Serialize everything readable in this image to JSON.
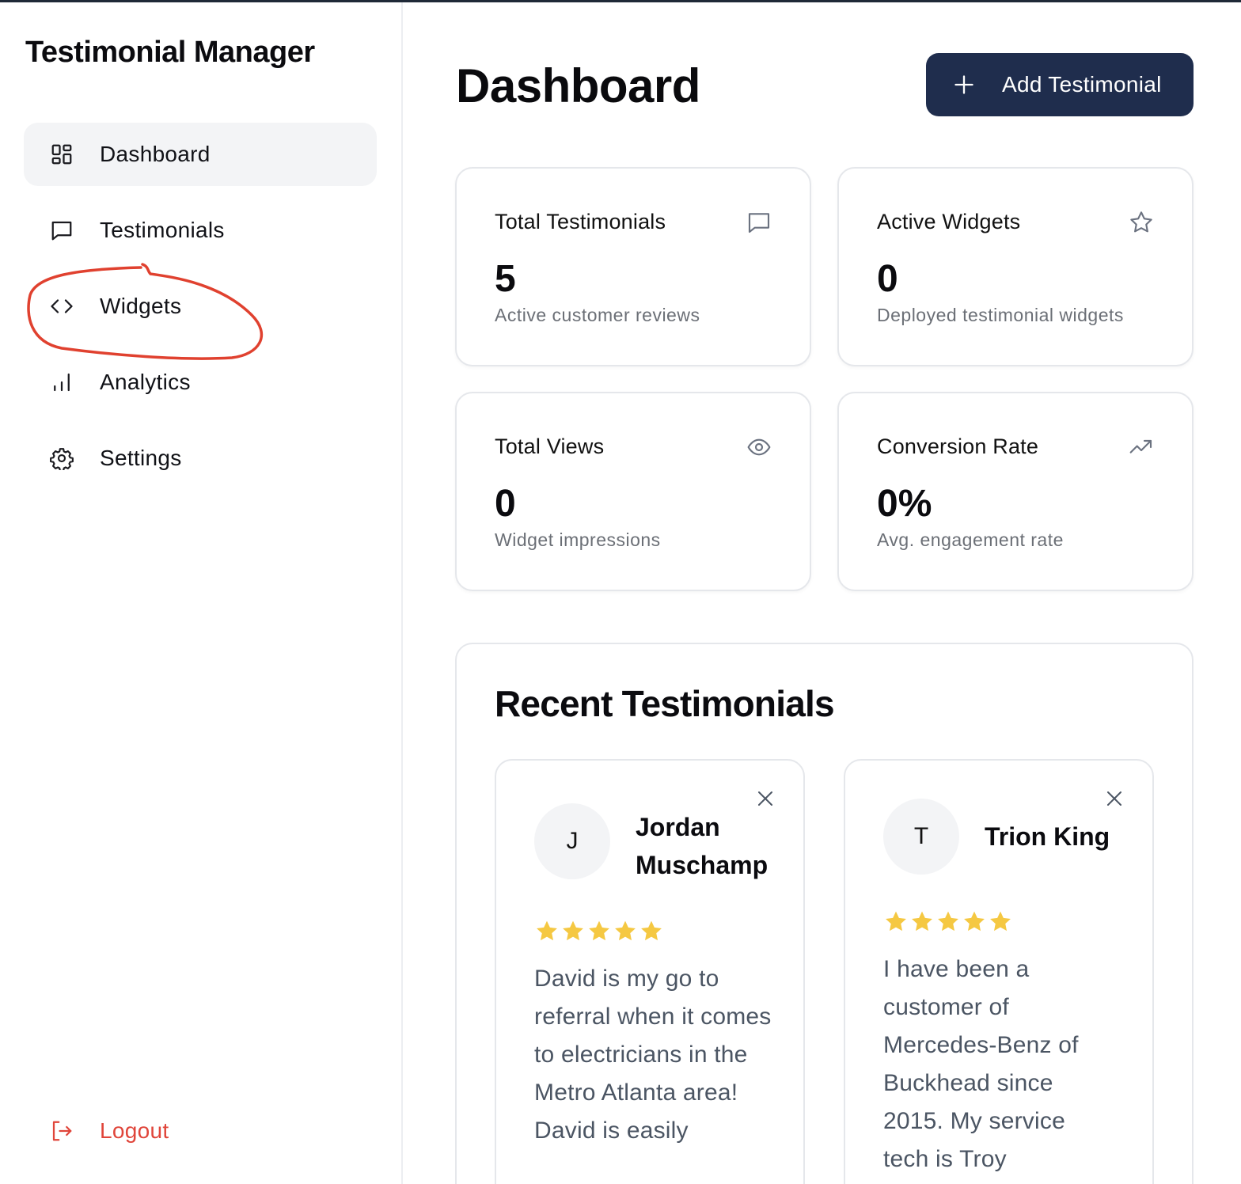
{
  "app": {
    "title": "Testimonial Manager"
  },
  "sidebar": {
    "items": [
      {
        "label": "Dashboard",
        "icon": "dashboard-grid-icon",
        "active": true
      },
      {
        "label": "Testimonials",
        "icon": "message-square-icon",
        "active": false
      },
      {
        "label": "Widgets",
        "icon": "code-icon",
        "active": false
      },
      {
        "label": "Analytics",
        "icon": "bar-chart-icon",
        "active": false
      },
      {
        "label": "Settings",
        "icon": "gear-icon",
        "active": false
      }
    ],
    "logout": {
      "label": "Logout",
      "icon": "logout-icon",
      "color": "#e0453a"
    }
  },
  "header": {
    "title": "Dashboard",
    "add_button": {
      "label": "Add Testimonial",
      "icon": "plus-icon",
      "color": "#1f2d4d"
    }
  },
  "stats": [
    {
      "title": "Total Testimonials",
      "value": "5",
      "subtitle": "Active customer reviews",
      "icon": "message-square-icon"
    },
    {
      "title": "Active Widgets",
      "value": "0",
      "subtitle": "Deployed testimonial widgets",
      "icon": "star-outline-icon"
    },
    {
      "title": "Total Views",
      "value": "0",
      "subtitle": "Widget impressions",
      "icon": "eye-icon"
    },
    {
      "title": "Conversion Rate",
      "value": "0%",
      "subtitle": "Avg. engagement rate",
      "icon": "trending-up-icon"
    }
  ],
  "recent": {
    "title": "Recent Testimonials",
    "items": [
      {
        "initial": "J",
        "name": "Jordan Muschamp",
        "rating": 5,
        "text": "David is my go to referral when it comes to electricians in the Metro Atlanta area! David is easily"
      },
      {
        "initial": "T",
        "name": "Trion King",
        "rating": 5,
        "text": "I have been a customer of Mercedes-Benz of Buckhead since 2015. My service tech is Troy"
      }
    ]
  },
  "colors": {
    "star": "#f5c842",
    "annotation": "#e0412f",
    "accent": "#1f2d4d"
  }
}
